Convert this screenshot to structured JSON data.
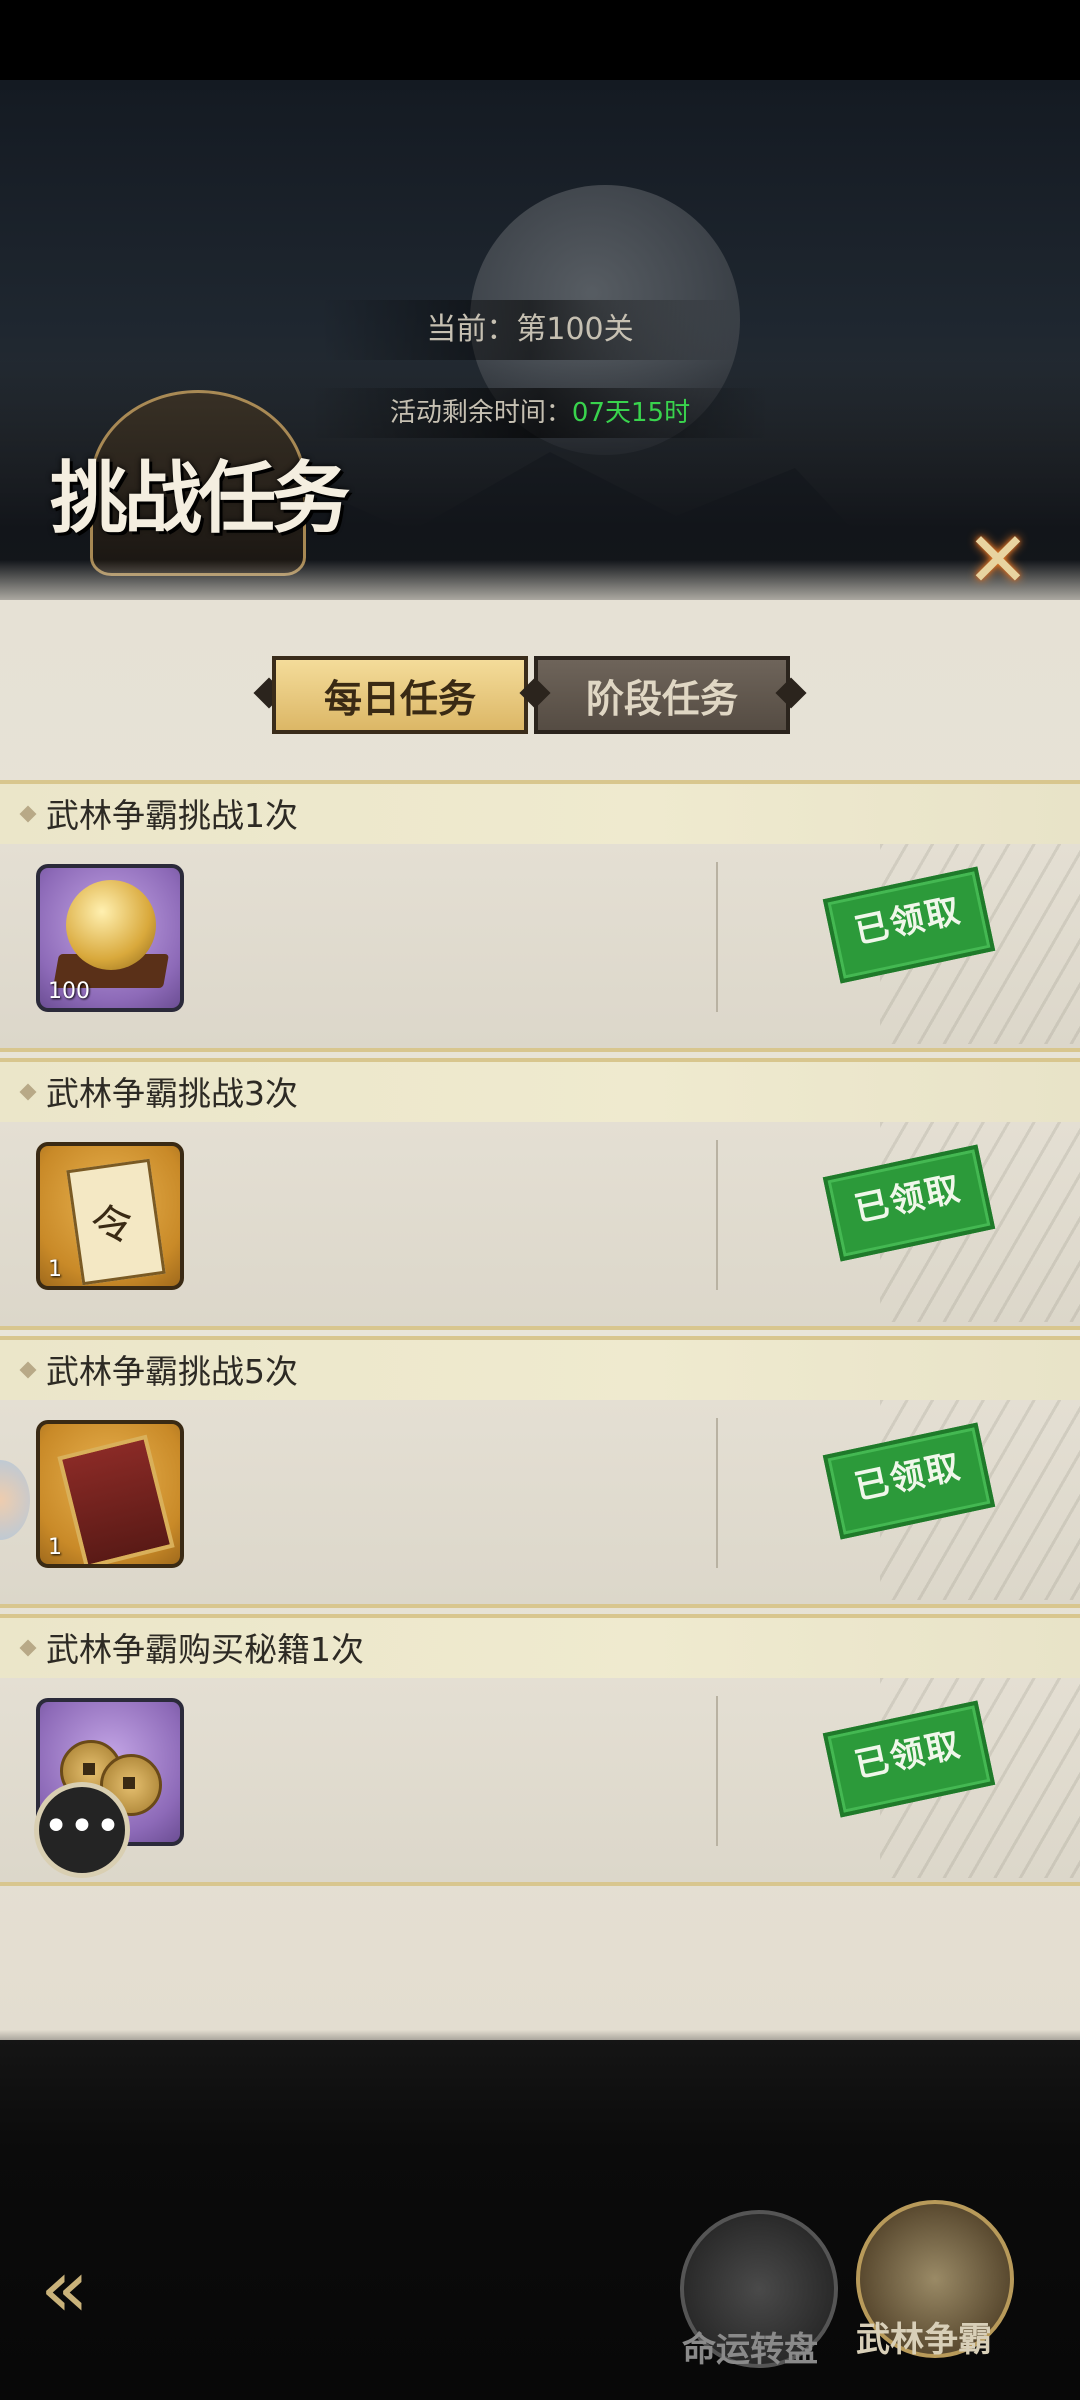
{
  "header": {
    "stage_label": "当前：第100关",
    "time_label": "活动剩余时间：",
    "time_value": "07天15时",
    "title": "挑战任务",
    "close_glyph": "✕"
  },
  "tabs": [
    {
      "label": "每日任务",
      "active": true
    },
    {
      "label": "阶段任务",
      "active": false
    }
  ],
  "tasks": [
    {
      "title": "武林争霸挑战1次",
      "reward_icon": "golden-orb-icon",
      "reward_count": "100",
      "status": "已领取"
    },
    {
      "title": "武林争霸挑战3次",
      "reward_icon": "scroll-token-icon",
      "reward_count": "1",
      "status": "已领取"
    },
    {
      "title": "武林争霸挑战5次",
      "reward_icon": "red-plaque-icon",
      "reward_count": "1",
      "status": "已领取"
    },
    {
      "title": "武林争霸购买秘籍1次",
      "reward_icon": "coins-icon",
      "reward_count": "",
      "status": "已领取"
    }
  ],
  "chat": {
    "glyph": "•••"
  },
  "footer": {
    "back_glyph": "«",
    "buttons": [
      {
        "label": "命运转盘"
      },
      {
        "label": "武林争霸"
      }
    ]
  },
  "colors": {
    "accent_gold": "#dcb766",
    "claimed_green": "#2c9a3a",
    "time_green": "#39d34d"
  }
}
